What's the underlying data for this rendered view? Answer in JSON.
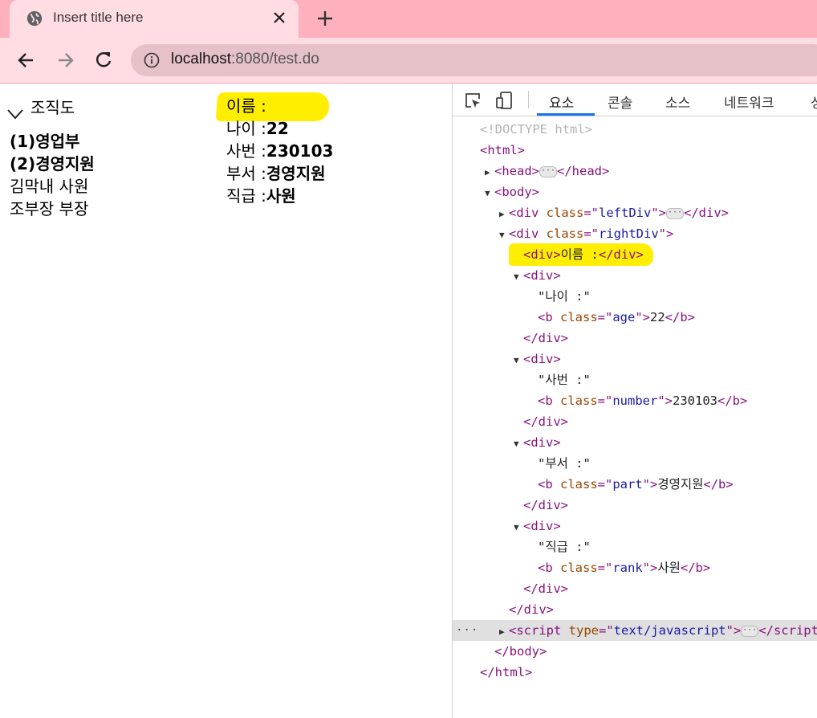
{
  "browser": {
    "tab_title": "Insert title here",
    "url_host": "localhost",
    "url_path": ":8080/test.do"
  },
  "page": {
    "tree_title": "조직도",
    "tree_items": [
      {
        "label": "(1)영업부",
        "bold": true
      },
      {
        "label": "(2)경영지원",
        "bold": true
      },
      {
        "label": "김막내 사원",
        "bold": false
      },
      {
        "label": "조부장 부장",
        "bold": false
      }
    ],
    "fields": [
      {
        "label": "이름 :",
        "value": ""
      },
      {
        "label": "나이 :",
        "value": "22"
      },
      {
        "label": "사번 :",
        "value": "230103"
      },
      {
        "label": "부서 :",
        "value": "경영지원"
      },
      {
        "label": "직급 :",
        "value": "사원"
      }
    ]
  },
  "devtools": {
    "tabs": [
      "요소",
      "콘솔",
      "소스",
      "네트워크",
      "성"
    ],
    "active_tab": "요소",
    "dom_lines": [
      {
        "indent": 0,
        "tri": "",
        "html": "<span class='doctype'>&lt;!DOCTYPE html&gt;</span>"
      },
      {
        "indent": 0,
        "tri": "",
        "html": "<span class='tag'>&lt;html&gt;</span>"
      },
      {
        "indent": 1,
        "tri": "▶",
        "html": "<span class='tag'>&lt;head&gt;</span><span class='ell'>···</span><span class='tag'>&lt;/head&gt;</span>"
      },
      {
        "indent": 1,
        "tri": "▼",
        "html": "<span class='tag'>&lt;body&gt;</span>"
      },
      {
        "indent": 2,
        "tri": "▶",
        "html": "<span class='tag'>&lt;div </span><span class='attr'>class</span><span class='tag'>=\"</span><span class='val'>leftDiv</span><span class='tag'>\"&gt;</span><span class='ell'>···</span><span class='tag'>&lt;/div&gt;</span>"
      },
      {
        "indent": 2,
        "tri": "▼",
        "html": "<span class='tag'>&lt;div </span><span class='attr'>class</span><span class='tag'>=\"</span><span class='val'>rightDiv</span><span class='tag'>\"&gt;</span>"
      },
      {
        "indent": 3,
        "tri": "",
        "html": "<span class='tag'>&lt;div&gt;</span><span class='txt'>이름 :</span><span class='tag'>&lt;/div&gt;</span>"
      },
      {
        "indent": 3,
        "tri": "▼",
        "html": "<span class='tag'>&lt;div&gt;</span>"
      },
      {
        "indent": 4,
        "tri": "",
        "html": "<span class='txt'>\"나이 :\"</span>"
      },
      {
        "indent": 4,
        "tri": "",
        "html": "<span class='tag'>&lt;b </span><span class='attr'>class</span><span class='tag'>=\"</span><span class='val'>age</span><span class='tag'>\"&gt;</span><span class='txt'>22</span><span class='tag'>&lt;/b&gt;</span>"
      },
      {
        "indent": 3,
        "tri": "",
        "html": "<span class='tag'>&lt;/div&gt;</span>"
      },
      {
        "indent": 3,
        "tri": "▼",
        "html": "<span class='tag'>&lt;div&gt;</span>"
      },
      {
        "indent": 4,
        "tri": "",
        "html": "<span class='txt'>\"사번 :\"</span>"
      },
      {
        "indent": 4,
        "tri": "",
        "html": "<span class='tag'>&lt;b </span><span class='attr'>class</span><span class='tag'>=\"</span><span class='val'>number</span><span class='tag'>\"&gt;</span><span class='txt'>230103</span><span class='tag'>&lt;/b&gt;</span>"
      },
      {
        "indent": 3,
        "tri": "",
        "html": "<span class='tag'>&lt;/div&gt;</span>"
      },
      {
        "indent": 3,
        "tri": "▼",
        "html": "<span class='tag'>&lt;div&gt;</span>"
      },
      {
        "indent": 4,
        "tri": "",
        "html": "<span class='txt'>\"부서 :\"</span>"
      },
      {
        "indent": 4,
        "tri": "",
        "html": "<span class='tag'>&lt;b </span><span class='attr'>class</span><span class='tag'>=\"</span><span class='val'>part</span><span class='tag'>\"&gt;</span><span class='txt'>경영지원</span><span class='tag'>&lt;/b&gt;</span>"
      },
      {
        "indent": 3,
        "tri": "",
        "html": "<span class='tag'>&lt;/div&gt;</span>"
      },
      {
        "indent": 3,
        "tri": "▼",
        "html": "<span class='tag'>&lt;div&gt;</span>"
      },
      {
        "indent": 4,
        "tri": "",
        "html": "<span class='txt'>\"직급 :\"</span>"
      },
      {
        "indent": 4,
        "tri": "",
        "html": "<span class='tag'>&lt;b </span><span class='attr'>class</span><span class='tag'>=\"</span><span class='val'>rank</span><span class='tag'>\"&gt;</span><span class='txt'>사원</span><span class='tag'>&lt;/b&gt;</span>"
      },
      {
        "indent": 3,
        "tri": "",
        "html": "<span class='tag'>&lt;/div&gt;</span>"
      },
      {
        "indent": 2,
        "tri": "",
        "html": "<span class='tag'>&lt;/div&gt;</span>"
      },
      {
        "indent": 2,
        "tri": "▶",
        "html": "<span class='tag'>&lt;script </span><span class='attr'>type</span><span class='tag'>=\"</span><span class='val'>text/javascript</span><span class='tag'>\"&gt;</span><span class='ell'>···</span><span class='tag'>&lt;/script&gt;</span>",
        "selected": true
      },
      {
        "indent": 1,
        "tri": "",
        "html": "<span class='tag'>&lt;/body&gt;</span>"
      },
      {
        "indent": 0,
        "tri": "",
        "html": "<span class='tag'>&lt;/html&gt;</span>"
      }
    ]
  }
}
